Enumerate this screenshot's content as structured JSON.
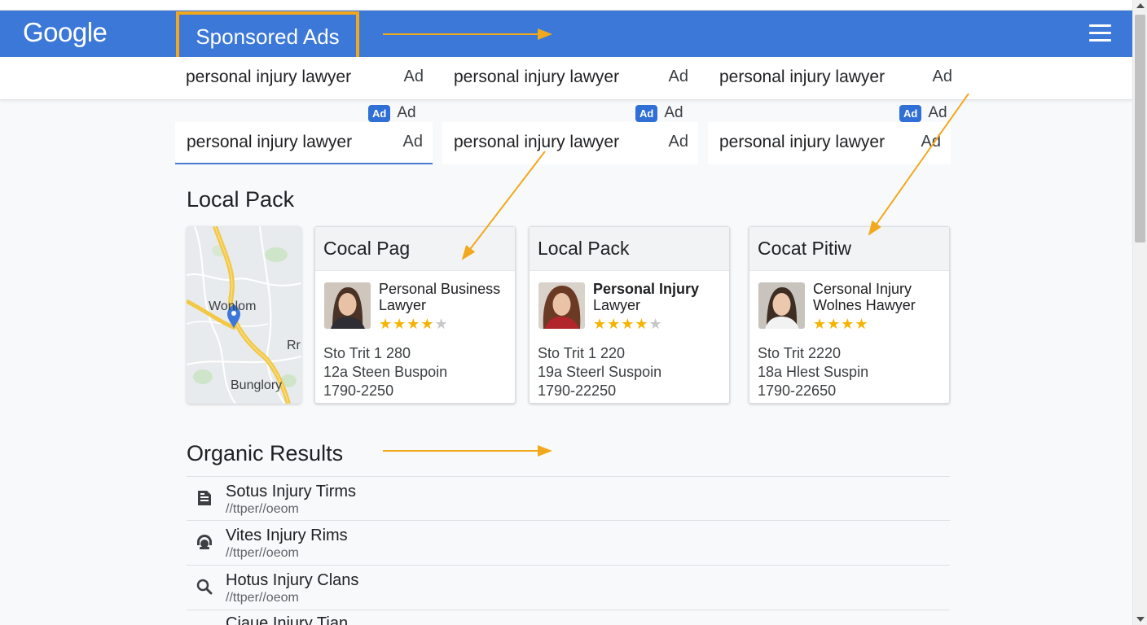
{
  "header": {
    "logo": "Google",
    "title": "Sponsored Ads"
  },
  "ads": {
    "row1": [
      {
        "query": "personal injury lawyer",
        "tag": "Ad"
      },
      {
        "query": "personal injury lawyer",
        "tag": "Ad"
      },
      {
        "query": "personal injury lawyer",
        "tag": "Ad"
      }
    ],
    "badges": [
      {
        "badge": "Ad",
        "label": "Ad"
      },
      {
        "badge": "Ad",
        "label": "Ad"
      },
      {
        "badge": "Ad",
        "label": "Ad"
      }
    ],
    "row2": [
      {
        "query": "personal injury lawyer",
        "tag": "Ad"
      },
      {
        "query": "personal injury lawyer",
        "tag": "Ad"
      },
      {
        "query": "personal injury lawyer",
        "tag": "Ad"
      }
    ]
  },
  "local_pack": {
    "title": "Local Pack",
    "map_labels": [
      "Wonlom",
      "Rr",
      "Bunglory"
    ],
    "cards": [
      {
        "header": "Cocal Pag",
        "name_line1": "Personal Business",
        "name_line2": "Lawyer",
        "stars": "★★★★",
        "half_star": "★",
        "line1": "Sto Trit 1 280",
        "line2": "12a Steen Buspoin",
        "line3": "1790-2250"
      },
      {
        "header": "Local Pack",
        "name_line1": "Personal Injury",
        "name_line2": "Lawyer",
        "stars": "★★★★",
        "half_star": "★",
        "line1": "Sto Trit 1 220",
        "line2": "19a Steerl Suspoin",
        "line3": "1790-22250"
      },
      {
        "header": "Cocat Pitiw",
        "name_line1": "Cersonal Injury",
        "name_line2": "Wolnes Hawyer",
        "stars": "★★★★",
        "half_star": "",
        "line1": "Sto Trit 2220",
        "line2": "18a Hlest Suspin",
        "line3": "1790-22650"
      }
    ]
  },
  "organic": {
    "title": "Organic Results",
    "items": [
      {
        "title": "Sotus Injury Tirms",
        "url": "//ttper//oeom",
        "icon": "document-icon"
      },
      {
        "title": "Vites Injury Rims",
        "url": "//ttper//oeom",
        "icon": "support-icon"
      },
      {
        "title": "Hotus Injury Clans",
        "url": "//ttper//oeom",
        "icon": "search-icon"
      },
      {
        "title": "Ciaue Injury Tian",
        "url": "",
        "icon": "list-icon"
      }
    ]
  },
  "colors": {
    "header_blue": "#3c78d8",
    "highlight_orange": "#f2a81d",
    "star_yellow": "#f4b400",
    "badge_blue": "#2f6fd6"
  }
}
